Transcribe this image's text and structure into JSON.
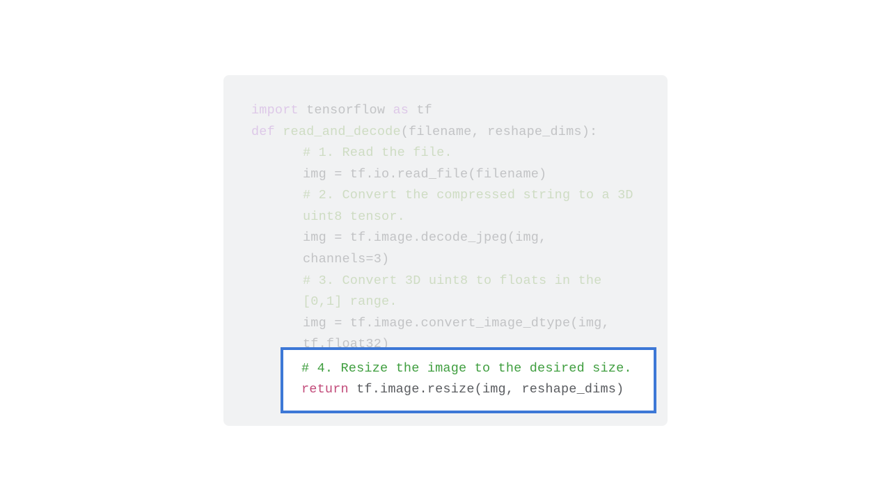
{
  "code": {
    "l1_import": "import",
    "l1_rest": " tensorflow ",
    "l1_as": "as",
    "l1_tf": " tf",
    "l2_def": "def",
    "l2_space": " ",
    "l2_fn": "read_and_decode",
    "l2_sig": "(filename, reshape_dims):",
    "l3_comment": "# 1. Read the file.",
    "l4": "img = tf.io.read_file(filename)",
    "l5_comment": "# 2. Convert the compressed string to a 3D uint8 tensor.",
    "l6": "img = tf.image.decode_jpeg(img, channels=3)",
    "l7_comment": "# 3. Convert 3D uint8 to floats in the [0,1] range.",
    "l8": "img = tf.image.convert_image_dtype(img, tf.float32)"
  },
  "highlight": {
    "comment": "# 4. Resize the image to the desired size.",
    "ret_kw": "return",
    "ret_rest": " tf.image.resize(img, reshape_dims)"
  }
}
